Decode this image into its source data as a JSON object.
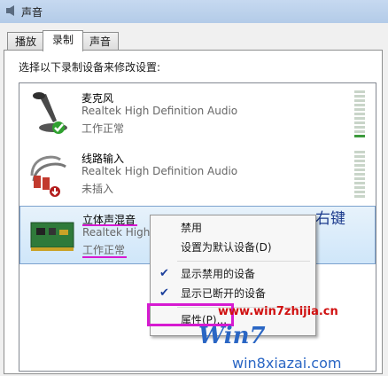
{
  "window": {
    "title": "声音"
  },
  "tabs": [
    {
      "label": "播放"
    },
    {
      "label": "录制"
    },
    {
      "label": "声音"
    }
  ],
  "instruction": "选择以下录制设备来修改设置:",
  "devices": [
    {
      "name": "麦克风",
      "description": "Realtek High Definition Audio",
      "status": "工作正常",
      "icon": "microphone-icon",
      "badge": "check-icon"
    },
    {
      "name": "线路输入",
      "description": "Realtek High Definition Audio",
      "status": "未插入",
      "icon": "line-in-cable-icon",
      "badge": "down-arrow-icon"
    },
    {
      "name": "立体声混音",
      "description": "Realtek High",
      "status": "工作正常",
      "icon": "sound-card-icon"
    }
  ],
  "annotation": "右键",
  "context_menu": {
    "items": [
      {
        "label": "禁用",
        "checked": false
      },
      {
        "label": "设置为默认设备(D)",
        "checked": false
      },
      {
        "label": "显示禁用的设备",
        "checked": true
      },
      {
        "label": "显示已断开的设备",
        "checked": true
      },
      {
        "label": "属性(P)...",
        "checked": false
      }
    ]
  },
  "watermark": {
    "url": "www.win7zhijia.cn",
    "logo": "Win7",
    "site": "win8xiazai.com"
  },
  "colors": {
    "highlight": "#d61ad1",
    "annotation": "#1b3a8c",
    "watermark_blue": "#2a66c4",
    "watermark_red": "#d01010"
  }
}
